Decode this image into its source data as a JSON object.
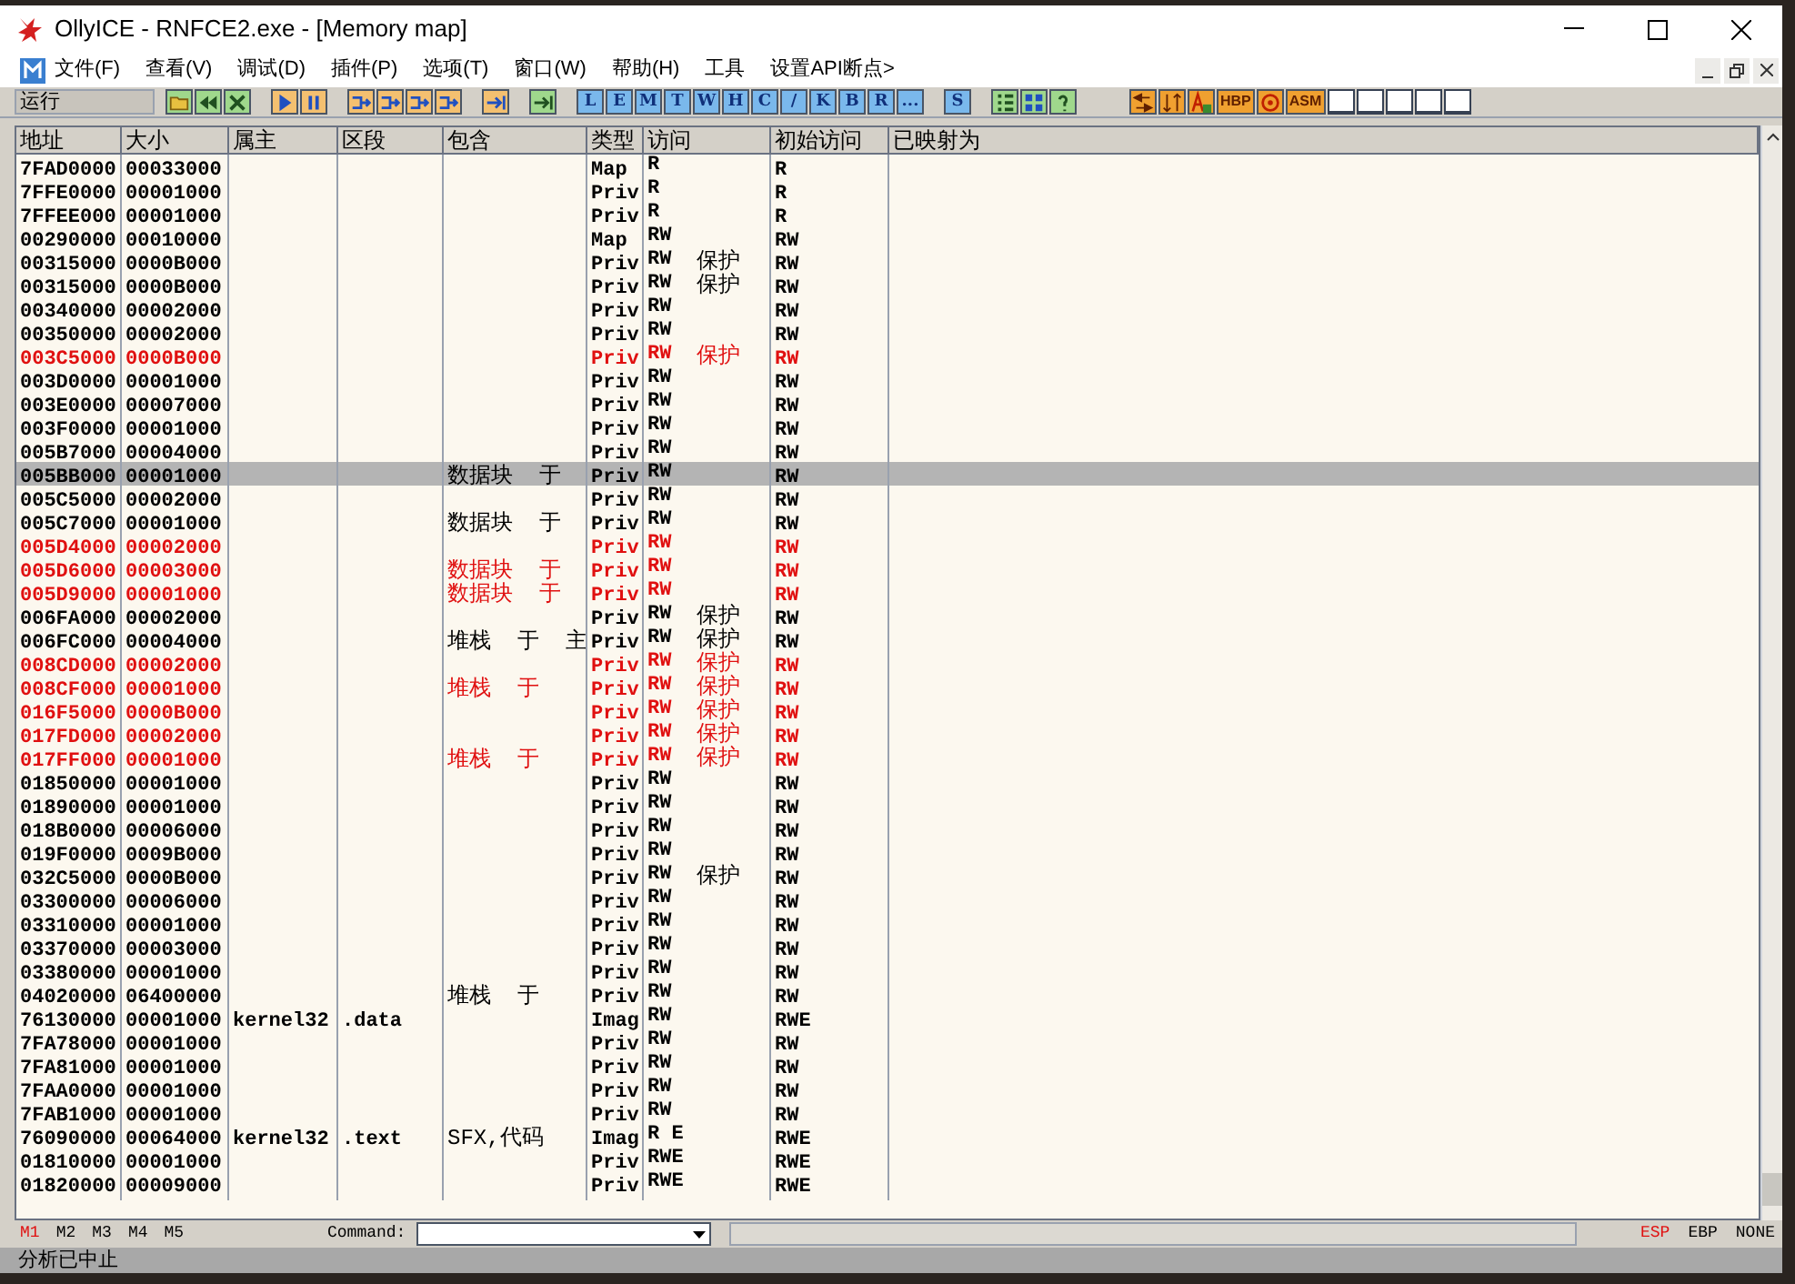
{
  "window": {
    "title": "OllyICE - RNFCE2.exe - [Memory map]"
  },
  "menu": [
    "文件(F)",
    "查看(V)",
    "调试(D)",
    "插件(P)",
    "选项(T)",
    "窗口(W)",
    "帮助(H)",
    "工具",
    "设置API断点>"
  ],
  "toolbar": {
    "run_state": "运行",
    "debug_groups": [
      [
        {
          "kind": "folder"
        },
        {
          "kind": "rewind"
        },
        {
          "kind": "close"
        }
      ],
      [
        {
          "kind": "play"
        },
        {
          "kind": "pause"
        }
      ],
      [
        {
          "kind": "step"
        },
        {
          "kind": "step"
        },
        {
          "kind": "step"
        },
        {
          "kind": "step"
        }
      ],
      [
        {
          "kind": "arrow"
        }
      ],
      [
        {
          "kind": "arrow-green"
        }
      ]
    ],
    "window_groups": [
      [
        "L",
        "E",
        "M",
        "T",
        "W",
        "H",
        "C",
        "/",
        "K",
        "B",
        "R",
        "..."
      ],
      [
        "S"
      ]
    ],
    "tool_buttons": [
      {
        "kind": "list"
      },
      {
        "kind": "grid"
      },
      {
        "kind": "help"
      }
    ],
    "plugin_buttons": [
      {
        "kind": "arrows"
      },
      {
        "kind": "sort"
      },
      {
        "kind": "font"
      },
      {
        "kind": "text",
        "label": "HBP"
      },
      {
        "kind": "target"
      },
      {
        "kind": "text",
        "label": "ASM"
      },
      {
        "kind": "blank"
      },
      {
        "kind": "blank"
      },
      {
        "kind": "blank"
      },
      {
        "kind": "blank"
      },
      {
        "kind": "blank"
      }
    ]
  },
  "table": {
    "columns": [
      "地址",
      "大小",
      "属主",
      "区段",
      "包含",
      "类型",
      "访问",
      "初始访问",
      "已映射为"
    ],
    "rows": [
      {
        "address": "7FAD0000",
        "size": "00033000",
        "type": "Map",
        "access": "R",
        "initial_access": "R",
        "highlighted": false,
        "selected": false
      },
      {
        "address": "7FFE0000",
        "size": "00001000",
        "type": "Priv",
        "access": "R",
        "initial_access": "R",
        "highlighted": false,
        "selected": false
      },
      {
        "address": "7FFEE000",
        "size": "00001000",
        "type": "Priv",
        "access": "R",
        "initial_access": "R",
        "highlighted": false,
        "selected": false
      },
      {
        "address": "00290000",
        "size": "00010000",
        "type": "Map",
        "access": "RW",
        "initial_access": "RW",
        "highlighted": false,
        "selected": false
      },
      {
        "address": "00315000",
        "size": "0000B000",
        "type": "Priv",
        "access": "RW",
        "guard": "保护",
        "initial_access": "RW",
        "highlighted": false,
        "selected": false
      },
      {
        "address": "00315000",
        "size": "0000B000",
        "type": "Priv",
        "access": "RW",
        "guard": "保护",
        "initial_access": "RW",
        "highlighted": false,
        "selected": false
      },
      {
        "address": "00340000",
        "size": "00002000",
        "type": "Priv",
        "access": "RW",
        "initial_access": "RW",
        "highlighted": false,
        "selected": false
      },
      {
        "address": "00350000",
        "size": "00002000",
        "type": "Priv",
        "access": "RW",
        "initial_access": "RW",
        "highlighted": false,
        "selected": false
      },
      {
        "address": "003C5000",
        "size": "0000B000",
        "type": "Priv",
        "access": "RW",
        "guard": "保护",
        "initial_access": "RW",
        "highlighted": true,
        "selected": false
      },
      {
        "address": "003D0000",
        "size": "00001000",
        "type": "Priv",
        "access": "RW",
        "initial_access": "RW",
        "highlighted": false,
        "selected": false
      },
      {
        "address": "003E0000",
        "size": "00007000",
        "type": "Priv",
        "access": "RW",
        "initial_access": "RW",
        "highlighted": false,
        "selected": false
      },
      {
        "address": "003F0000",
        "size": "00001000",
        "type": "Priv",
        "access": "RW",
        "initial_access": "RW",
        "highlighted": false,
        "selected": false
      },
      {
        "address": "005B7000",
        "size": "00004000",
        "type": "Priv",
        "access": "RW",
        "initial_access": "RW",
        "highlighted": false,
        "selected": false
      },
      {
        "address": "005BB000",
        "size": "00001000",
        "contains": "数据块  于",
        "type": "Priv",
        "access": "RW",
        "initial_access": "RW",
        "highlighted": false,
        "selected": true
      },
      {
        "address": "005C5000",
        "size": "00002000",
        "type": "Priv",
        "access": "RW",
        "initial_access": "RW",
        "highlighted": false,
        "selected": false
      },
      {
        "address": "005C7000",
        "size": "00001000",
        "contains": "数据块  于",
        "type": "Priv",
        "access": "RW",
        "initial_access": "RW",
        "highlighted": false,
        "selected": false
      },
      {
        "address": "005D4000",
        "size": "00002000",
        "type": "Priv",
        "access": "RW",
        "initial_access": "RW",
        "highlighted": true,
        "selected": false
      },
      {
        "address": "005D6000",
        "size": "00003000",
        "contains": "数据块  于",
        "type": "Priv",
        "access": "RW",
        "initial_access": "RW",
        "highlighted": true,
        "selected": false
      },
      {
        "address": "005D9000",
        "size": "00001000",
        "contains": "数据块  于",
        "type": "Priv",
        "access": "RW",
        "initial_access": "RW",
        "highlighted": true,
        "selected": false
      },
      {
        "address": "006FA000",
        "size": "00002000",
        "type": "Priv",
        "access": "RW",
        "guard": "保护",
        "initial_access": "RW",
        "highlighted": false,
        "selected": false
      },
      {
        "address": "006FC000",
        "size": "00004000",
        "contains": "堆栈  于  主",
        "type": "Priv",
        "access": "RW",
        "guard": "保护",
        "initial_access": "RW",
        "highlighted": false,
        "selected": false
      },
      {
        "address": "008CD000",
        "size": "00002000",
        "type": "Priv",
        "access": "RW",
        "guard": "保护",
        "initial_access": "RW",
        "highlighted": true,
        "selected": false
      },
      {
        "address": "008CF000",
        "size": "00001000",
        "contains": "堆栈  于",
        "type": "Priv",
        "access": "RW",
        "guard": "保护",
        "initial_access": "RW",
        "highlighted": true,
        "selected": false
      },
      {
        "address": "016F5000",
        "size": "0000B000",
        "type": "Priv",
        "access": "RW",
        "guard": "保护",
        "initial_access": "RW",
        "highlighted": true,
        "selected": false
      },
      {
        "address": "017FD000",
        "size": "00002000",
        "type": "Priv",
        "access": "RW",
        "guard": "保护",
        "initial_access": "RW",
        "highlighted": true,
        "selected": false
      },
      {
        "address": "017FF000",
        "size": "00001000",
        "contains": "堆栈  于",
        "type": "Priv",
        "access": "RW",
        "guard": "保护",
        "initial_access": "RW",
        "highlighted": true,
        "selected": false
      },
      {
        "address": "01850000",
        "size": "00001000",
        "type": "Priv",
        "access": "RW",
        "initial_access": "RW",
        "highlighted": false,
        "selected": false
      },
      {
        "address": "01890000",
        "size": "00001000",
        "type": "Priv",
        "access": "RW",
        "initial_access": "RW",
        "highlighted": false,
        "selected": false
      },
      {
        "address": "018B0000",
        "size": "00006000",
        "type": "Priv",
        "access": "RW",
        "initial_access": "RW",
        "highlighted": false,
        "selected": false
      },
      {
        "address": "019F0000",
        "size": "0009B000",
        "type": "Priv",
        "access": "RW",
        "initial_access": "RW",
        "highlighted": false,
        "selected": false
      },
      {
        "address": "032C5000",
        "size": "0000B000",
        "type": "Priv",
        "access": "RW",
        "guard": "保护",
        "initial_access": "RW",
        "highlighted": false,
        "selected": false
      },
      {
        "address": "03300000",
        "size": "00006000",
        "type": "Priv",
        "access": "RW",
        "initial_access": "RW",
        "highlighted": false,
        "selected": false
      },
      {
        "address": "03310000",
        "size": "00001000",
        "type": "Priv",
        "access": "RW",
        "initial_access": "RW",
        "highlighted": false,
        "selected": false
      },
      {
        "address": "03370000",
        "size": "00003000",
        "type": "Priv",
        "access": "RW",
        "initial_access": "RW",
        "highlighted": false,
        "selected": false
      },
      {
        "address": "03380000",
        "size": "00001000",
        "type": "Priv",
        "access": "RW",
        "initial_access": "RW",
        "highlighted": false,
        "selected": false
      },
      {
        "address": "04020000",
        "size": "06400000",
        "contains": "堆栈  于",
        "type": "Priv",
        "access": "RW",
        "initial_access": "RW",
        "highlighted": false,
        "selected": false
      },
      {
        "address": "76130000",
        "size": "00001000",
        "owner": "kernel32",
        "section": ".data",
        "type": "Imag",
        "access": "RW",
        "initial_access": "RWE",
        "highlighted": false,
        "selected": false
      },
      {
        "address": "7FA78000",
        "size": "00001000",
        "type": "Priv",
        "access": "RW",
        "initial_access": "RW",
        "highlighted": false,
        "selected": false
      },
      {
        "address": "7FA81000",
        "size": "00001000",
        "type": "Priv",
        "access": "RW",
        "initial_access": "RW",
        "highlighted": false,
        "selected": false
      },
      {
        "address": "7FAA0000",
        "size": "00001000",
        "type": "Priv",
        "access": "RW",
        "initial_access": "RW",
        "highlighted": false,
        "selected": false
      },
      {
        "address": "7FAB1000",
        "size": "00001000",
        "type": "Priv",
        "access": "RW",
        "initial_access": "RW",
        "highlighted": false,
        "selected": false
      },
      {
        "address": "76090000",
        "size": "00064000",
        "owner": "kernel32",
        "section": ".text",
        "contains": "SFX,代码",
        "type": "Imag",
        "access": "R E",
        "initial_access": "RWE",
        "highlighted": false,
        "selected": false
      },
      {
        "address": "01810000",
        "size": "00001000",
        "type": "Priv",
        "access": "RWE",
        "initial_access": "RWE",
        "highlighted": false,
        "selected": false
      },
      {
        "address": "01820000",
        "size": "00009000",
        "type": "Priv",
        "access": "RWE",
        "initial_access": "RWE",
        "highlighted": false,
        "selected": false
      }
    ]
  },
  "command_bar": {
    "memory_slots": [
      {
        "label": "M1",
        "selected": true
      },
      {
        "label": "M2",
        "selected": false
      },
      {
        "label": "M3",
        "selected": false
      },
      {
        "label": "M4",
        "selected": false
      },
      {
        "label": "M5",
        "selected": false
      }
    ],
    "command_label": "Command:",
    "registers": [
      {
        "label": "ESP",
        "selected": true
      },
      {
        "label": "EBP",
        "selected": false
      },
      {
        "label": "NONE",
        "selected": false
      }
    ]
  },
  "status_bar": "分析已中止"
}
